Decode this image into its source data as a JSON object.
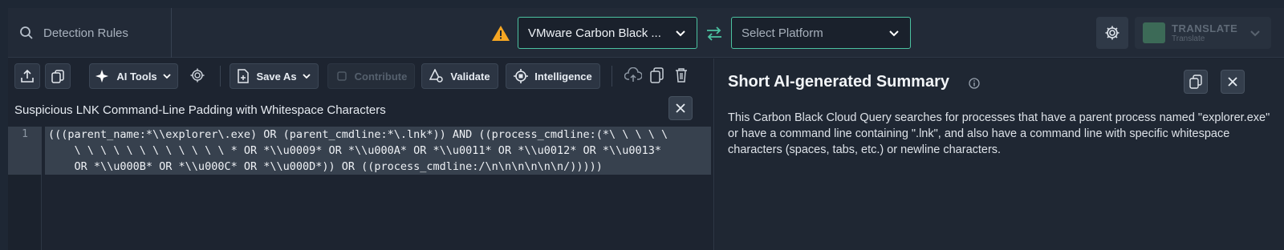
{
  "search": {
    "placeholder": "Detection Rules"
  },
  "header": {
    "source_platform": "VMware Carbon Black ...",
    "target_platform": "Select Platform",
    "translate_label": "TRANSLATE",
    "translate_sub": "Translate"
  },
  "toolbar": {
    "ai_tools": "AI Tools",
    "save_as": "Save As",
    "contribute": "Contribute",
    "validate": "Validate",
    "intelligence": "Intelligence"
  },
  "editor": {
    "title": "Suspicious LNK Command-Line Padding with Whitespace Characters",
    "line_number": "1",
    "code": "(((parent_name:*\\\\explorer\\.exe) OR (parent_cmdline:*\\.lnk*)) AND ((process_cmdline:(*\\ \\ \\ \\ \\\n    \\ \\ \\ \\ \\ \\ \\ \\ \\ \\ \\ \\ * OR *\\\\u0009* OR *\\\\u000A* OR *\\\\u0011* OR *\\\\u0012* OR *\\\\u0013*\n    OR *\\\\u000B* OR *\\\\u000C* OR *\\\\u000D*)) OR ((process_cmdline:/\\n\\n\\n\\n\\n\\n/)))))"
  },
  "summary": {
    "title": "Short AI-generated Summary",
    "body": "This Carbon Black Cloud Query searches for processes that have a parent process named \"explorer.exe\" or have a command line containing \".lnk\", and also have a command line with specific whitespace characters (spaces, tabs, etc.) or newline characters."
  },
  "colors": {
    "accent": "#4cc2a1",
    "warning": "#f5a623"
  }
}
